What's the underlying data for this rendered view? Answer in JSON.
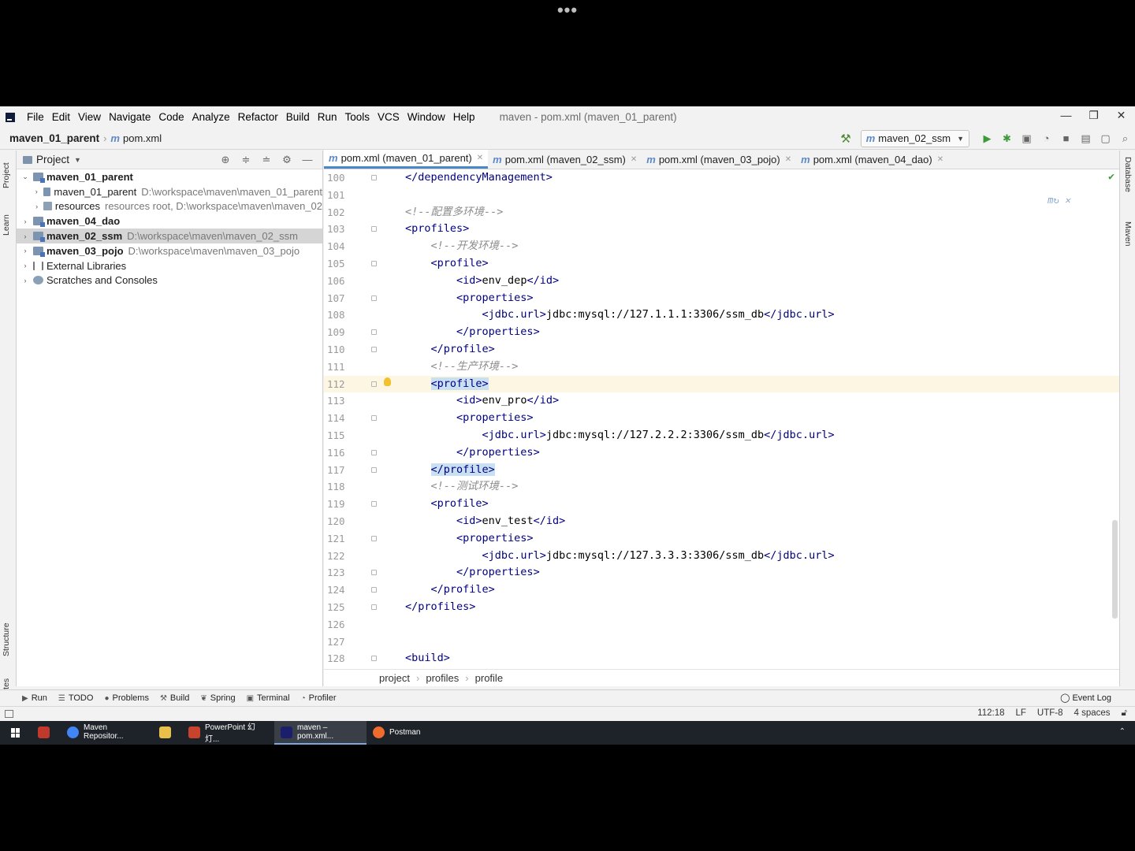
{
  "menu": {
    "items": [
      "File",
      "Edit",
      "View",
      "Navigate",
      "Code",
      "Analyze",
      "Refactor",
      "Build",
      "Run",
      "Tools",
      "VCS",
      "Window",
      "Help"
    ],
    "window_title": "maven - pom.xml (maven_01_parent)"
  },
  "nav": {
    "project": "maven_01_parent",
    "file": "pom.xml",
    "run_config": "maven_02_ssm"
  },
  "project_panel": {
    "title": "Project",
    "tree": [
      {
        "name": "maven_01_parent",
        "path": ""
      },
      {
        "name": "maven_01_parent",
        "path": "D:\\workspace\\maven\\maven_01_parent"
      },
      {
        "name": "resources",
        "path": "resources root,  D:\\workspace\\maven\\maven_02"
      },
      {
        "name": "maven_04_dao",
        "path": ""
      },
      {
        "name": "maven_02_ssm",
        "path": "D:\\workspace\\maven\\maven_02_ssm"
      },
      {
        "name": "maven_03_pojo",
        "path": "D:\\workspace\\maven\\maven_03_pojo"
      },
      {
        "name": "External Libraries",
        "path": ""
      },
      {
        "name": "Scratches and Consoles",
        "path": ""
      }
    ]
  },
  "side_stripes": {
    "left": [
      "Project",
      "Learn",
      "Structure",
      "Favorites"
    ],
    "right": [
      "Database",
      "Maven"
    ]
  },
  "editor": {
    "tabs": [
      "pom.xml (maven_01_parent)",
      "pom.xml (maven_02_ssm)",
      "pom.xml (maven_03_pojo)",
      "pom.xml (maven_04_dao)"
    ],
    "lines": [
      {
        "n": "100",
        "code": "</dependencyManagement>"
      },
      {
        "n": "101",
        "code": ""
      },
      {
        "n": "102",
        "code": "<!--配置多环境-->"
      },
      {
        "n": "103",
        "code": "<profiles>"
      },
      {
        "n": "104",
        "code": "    <!--开发环境-->"
      },
      {
        "n": "105",
        "code": "    <profile>"
      },
      {
        "n": "106",
        "code": "        <id>env_dep</id>"
      },
      {
        "n": "107",
        "code": "        <properties>"
      },
      {
        "n": "108",
        "code": "            <jdbc.url>jdbc:mysql://127.1.1.1:3306/ssm_db</jdbc.url>"
      },
      {
        "n": "109",
        "code": "        </properties>"
      },
      {
        "n": "110",
        "code": "    </profile>"
      },
      {
        "n": "111",
        "code": "    <!--生产环境-->"
      },
      {
        "n": "112",
        "code": "    <profile>"
      },
      {
        "n": "113",
        "code": "        <id>env_pro</id>"
      },
      {
        "n": "114",
        "code": "        <properties>"
      },
      {
        "n": "115",
        "code": "            <jdbc.url>jdbc:mysql://127.2.2.2:3306/ssm_db</jdbc.url>"
      },
      {
        "n": "116",
        "code": "        </properties>"
      },
      {
        "n": "117",
        "code": "    </profile>"
      },
      {
        "n": "118",
        "code": "    <!--测试环境-->"
      },
      {
        "n": "119",
        "code": "    <profile>"
      },
      {
        "n": "120",
        "code": "        <id>env_test</id>"
      },
      {
        "n": "121",
        "code": "        <properties>"
      },
      {
        "n": "122",
        "code": "            <jdbc.url>jdbc:mysql://127.3.3.3:3306/ssm_db</jdbc.url>"
      },
      {
        "n": "123",
        "code": "        </properties>"
      },
      {
        "n": "124",
        "code": "    </profile>"
      },
      {
        "n": "125",
        "code": "</profiles>"
      },
      {
        "n": "126",
        "code": ""
      },
      {
        "n": "127",
        "code": ""
      },
      {
        "n": "128",
        "code": "<build>"
      }
    ],
    "current_line": "112",
    "breadcrumb": [
      "project",
      "profiles",
      "profile"
    ]
  },
  "bottom_tools": [
    "Run",
    "TODO",
    "Problems",
    "Build",
    "Spring",
    "Terminal",
    "Profiler"
  ],
  "event_log": "Event Log",
  "status": {
    "position": "112:18",
    "line_sep": "LF",
    "encoding": "UTF-8",
    "indent": "4 spaces"
  },
  "taskbar": {
    "apps": [
      {
        "label": "Maven Repositor...",
        "color": "#4285f4"
      },
      {
        "label": "PowerPoint 幻灯...",
        "color": "#c8432b"
      },
      {
        "label": "maven – pom.xml...",
        "color": "#1b1f6b"
      },
      {
        "label": "Postman",
        "color": "#ef6c2f"
      }
    ]
  }
}
